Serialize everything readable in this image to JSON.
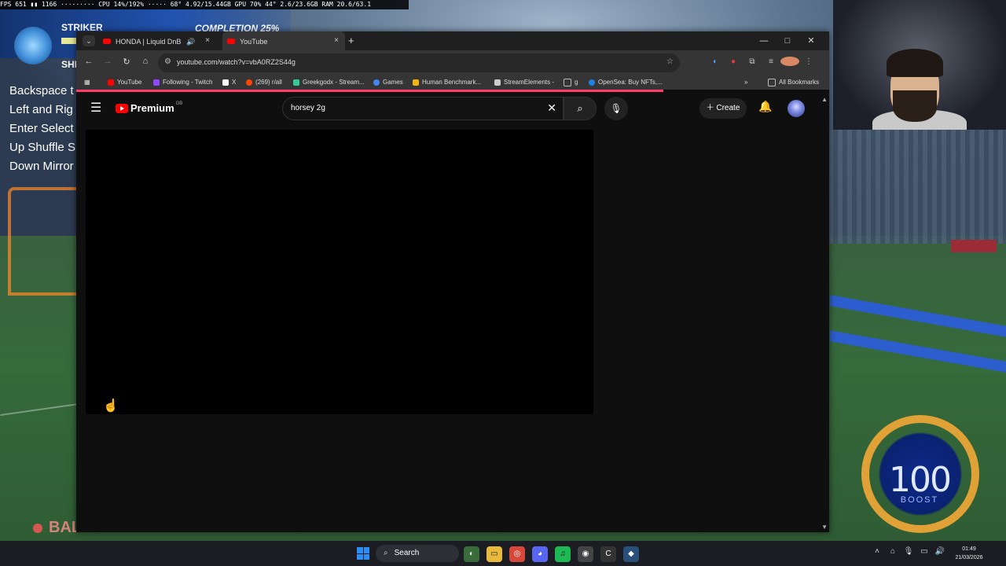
{
  "hud": {
    "stats": "FPS 651 ▮▮ 1166 ·········  CPU 14%/192%  ·····  68°  4.92/15.44GB  GPU 70%  44°  2.6/23.6GB  RAM 20.6/63.1",
    "striker_title": "STRIKER",
    "completion": "COMPLETION 25%",
    "completion_fraction": 0.25,
    "striker_sub": "SHI",
    "controls": [
      "Backspace t",
      "Left and Rig",
      "Enter Select",
      "Up Shuffle S",
      "Down Mirror"
    ],
    "ball_cam": "BALL CAM",
    "boost_value": "100",
    "boost_label": "BOOST"
  },
  "browser": {
    "tabs": [
      {
        "title": "HONDA | Liquid DnB / Jung",
        "audio": "🔊",
        "close": "×"
      },
      {
        "title": "YouTube",
        "close": "×"
      }
    ],
    "new_tab": "+",
    "window_controls": {
      "minimize": "—",
      "maximize": "□",
      "close": "✕"
    },
    "nav": {
      "back": "←",
      "forward": "→",
      "reload": "↻",
      "home": "⌂"
    },
    "url": "youtube.com/watch?v=vbA0RZ2S44g",
    "bookmarks": [
      {
        "label": "YouTube",
        "color": "#ff0000"
      },
      {
        "label": "Following - Twitch",
        "color": "#9146ff"
      },
      {
        "label": "X",
        "color": "#ffffff"
      },
      {
        "label": "(269) r/all",
        "color": "#ff4500"
      },
      {
        "label": "Greekgodx - Stream...",
        "color": "#33cc99"
      },
      {
        "label": "Games",
        "color": "#4285f4"
      },
      {
        "label": "Human Benchmark...",
        "color": "#f2b40b"
      },
      {
        "label": "StreamElements -",
        "color": "#cccccc"
      },
      {
        "label": "g",
        "color": "#bbbbbb"
      },
      {
        "label": "OpenSea: Buy NFTs,...",
        "color": "#2081e2"
      }
    ],
    "bookmarks_overflow": "»",
    "all_bookmarks": "All Bookmarks",
    "load_progress": 0.78
  },
  "youtube": {
    "logo_text": "Premium",
    "logo_region": "GB",
    "search_query": "horsey 2g",
    "create_label": "Create"
  },
  "taskbar": {
    "search_label": "Search",
    "time": "01:49",
    "date": "21/03/2026"
  },
  "colors": {
    "youtube_red": "#ff0000",
    "accent_blue": "#2b8ef5",
    "boost_orange": "#ffad36"
  }
}
